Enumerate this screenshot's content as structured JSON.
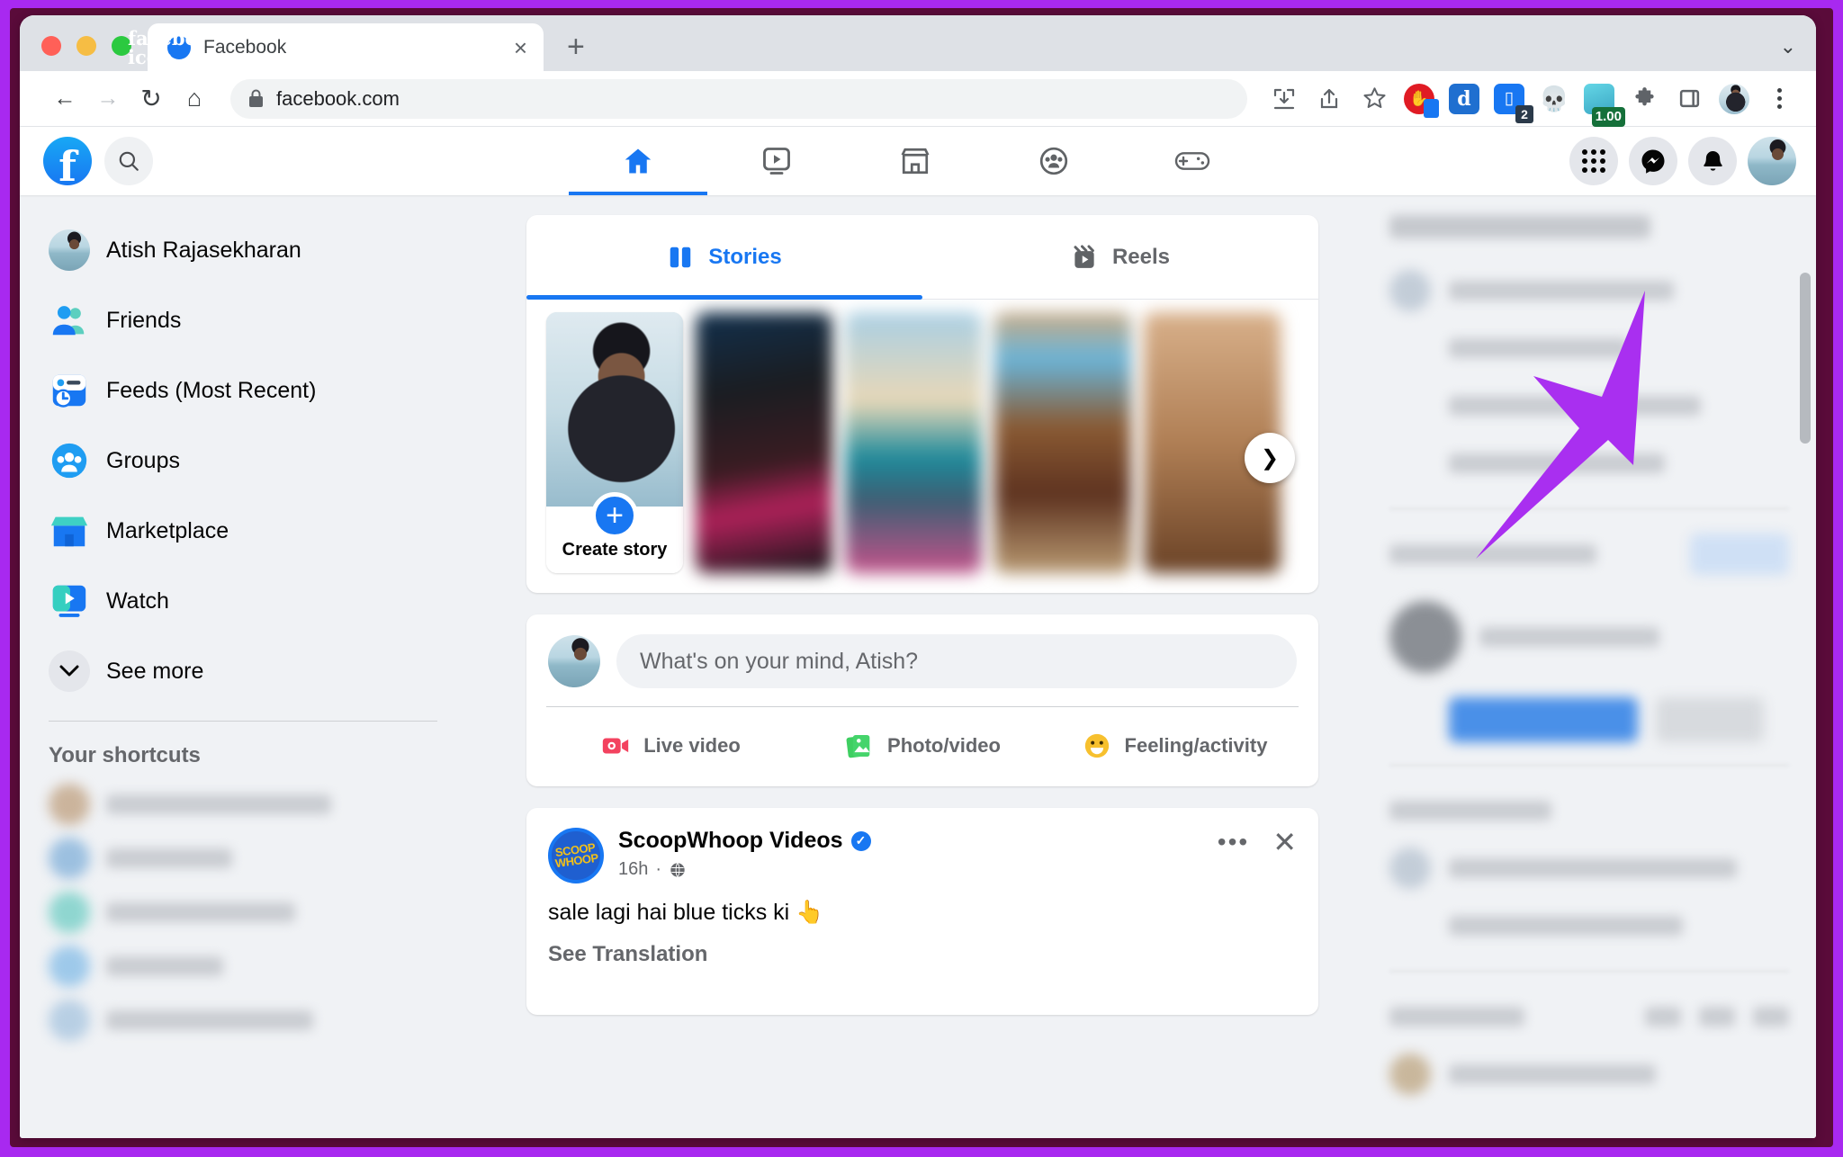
{
  "browser": {
    "tab": {
      "title": "Facebook",
      "favicon": "facebook-icon",
      "close": "×"
    },
    "new_tab": "+",
    "tabstrip_chevron": "⌄",
    "back": "←",
    "forward": "→",
    "reload": "↻",
    "home": "⌂",
    "omnibox": {
      "lock": "🔒",
      "url": "facebook.com"
    },
    "toolbar_icons": [
      {
        "name": "download-icon",
        "glyph": "⤓"
      },
      {
        "name": "share-icon",
        "glyph": "⇧"
      },
      {
        "name": "bookmark-star-icon",
        "glyph": "☆"
      },
      {
        "name": "adblock-extension-icon",
        "glyph": "✋"
      },
      {
        "name": "grammarly-extension-icon",
        "glyph": "G"
      },
      {
        "name": "tab-manager-extension-icon",
        "glyph": "▮",
        "badge": "2"
      },
      {
        "name": "skull-extension-icon",
        "glyph": "💀"
      },
      {
        "name": "currency-extension-icon",
        "glyph": "",
        "badge": "1.00"
      },
      {
        "name": "extensions-puzzle-icon",
        "glyph": "🧩"
      },
      {
        "name": "side-panel-icon",
        "glyph": "▯"
      },
      {
        "name": "browser-profile-avatar",
        "glyph": ""
      },
      {
        "name": "chrome-menu-icon",
        "glyph": "⋮"
      }
    ]
  },
  "fb_nav": {
    "logo": "f",
    "search": "search-icon",
    "tabs": [
      {
        "name": "home",
        "icon": "home-icon",
        "active": true
      },
      {
        "name": "video",
        "icon": "video-icon",
        "active": false
      },
      {
        "name": "marketplace",
        "icon": "marketplace-icon",
        "active": false
      },
      {
        "name": "groups",
        "icon": "groups-icon",
        "active": false
      },
      {
        "name": "gaming",
        "icon": "gaming-icon",
        "active": false
      }
    ],
    "right": [
      {
        "name": "menu-grid",
        "icon": "grid-icon"
      },
      {
        "name": "messenger",
        "icon": "messenger-icon"
      },
      {
        "name": "notifications",
        "icon": "bell-icon"
      },
      {
        "name": "account",
        "icon": "avatar"
      }
    ]
  },
  "sidebar": {
    "items": [
      {
        "label": "Atish Rajasekharan",
        "icon": "user-avatar"
      },
      {
        "label": "Friends",
        "icon": "friends-icon"
      },
      {
        "label": "Feeds (Most Recent)",
        "icon": "feeds-icon"
      },
      {
        "label": "Groups",
        "icon": "groups-icon"
      },
      {
        "label": "Marketplace",
        "icon": "marketplace-icon"
      },
      {
        "label": "Watch",
        "icon": "watch-icon"
      },
      {
        "label": "See more",
        "icon": "chevron-down-icon"
      }
    ],
    "shortcuts_title": "Your shortcuts"
  },
  "stories": {
    "tabs": [
      {
        "label": "Stories",
        "icon": "stories-icon",
        "active": true
      },
      {
        "label": "Reels",
        "icon": "reels-icon",
        "active": false
      }
    ],
    "create": {
      "label": "Create story",
      "plus": "+"
    },
    "next": "❯"
  },
  "composer": {
    "placeholder": "What's on your mind, Atish?",
    "actions": [
      {
        "label": "Live video",
        "icon": "live-video-icon"
      },
      {
        "label": "Photo/video",
        "icon": "photo-video-icon"
      },
      {
        "label": "Feeling/activity",
        "icon": "feeling-activity-icon"
      }
    ]
  },
  "post": {
    "author": "ScoopWhoop Videos",
    "verified": "✓",
    "logo_text": "SCOOP WHOOP",
    "time": "16h",
    "separator": "·",
    "privacy": "🌐",
    "text": "sale lagi hai blue ticks ki 👆",
    "see_translation": "See Translation",
    "more": "•••",
    "close": "✕"
  },
  "colors": {
    "accent": "#1877f2",
    "frame": "#a829f0",
    "arrow": "#a92ff0",
    "page_bg": "#f0f2f5"
  }
}
